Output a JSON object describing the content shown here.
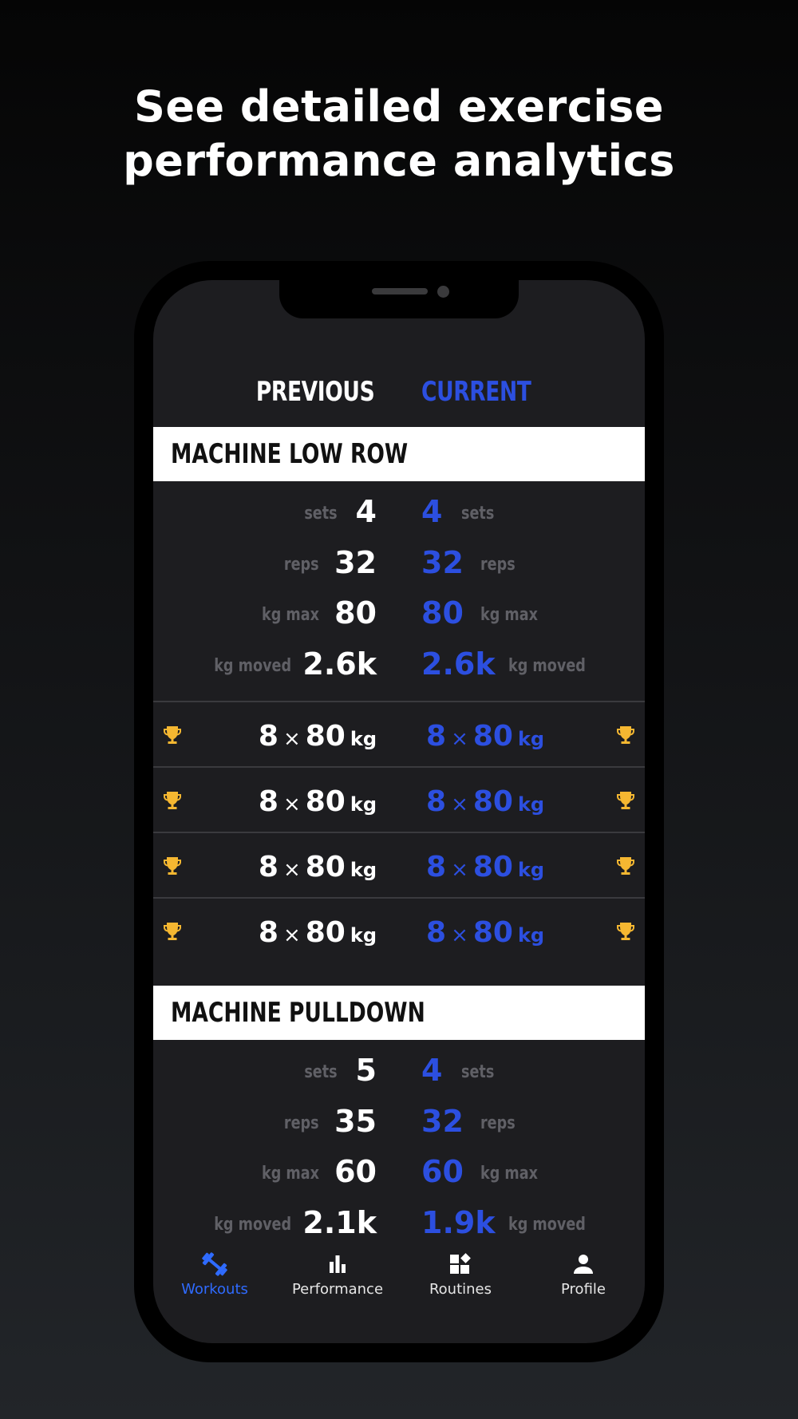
{
  "headline": {
    "line1": "See detailed exercise",
    "line2": "performance analytics"
  },
  "columns": {
    "previous": "PREVIOUS",
    "current": "CURRENT"
  },
  "exercises": [
    {
      "title": "MACHINE LOW ROW",
      "stats": [
        {
          "label": "sets",
          "prev": "4",
          "curr": "4"
        },
        {
          "label": "reps",
          "prev": "32",
          "curr": "32"
        },
        {
          "label": "kg max",
          "prev": "80",
          "curr": "80"
        },
        {
          "label": "kg moved",
          "prev": "2.6k",
          "curr": "2.6k"
        }
      ],
      "sets": [
        {
          "prev_reps": "8",
          "prev_weight": "80",
          "curr_reps": "8",
          "curr_weight": "80",
          "unit": "kg",
          "x": "×"
        },
        {
          "prev_reps": "8",
          "prev_weight": "80",
          "curr_reps": "8",
          "curr_weight": "80",
          "unit": "kg",
          "x": "×"
        },
        {
          "prev_reps": "8",
          "prev_weight": "80",
          "curr_reps": "8",
          "curr_weight": "80",
          "unit": "kg",
          "x": "×"
        },
        {
          "prev_reps": "8",
          "prev_weight": "80",
          "curr_reps": "8",
          "curr_weight": "80",
          "unit": "kg",
          "x": "×"
        }
      ]
    },
    {
      "title": "MACHINE PULLDOWN",
      "stats": [
        {
          "label": "sets",
          "prev": "5",
          "curr": "4"
        },
        {
          "label": "reps",
          "prev": "35",
          "curr": "32"
        },
        {
          "label": "kg max",
          "prev": "60",
          "curr": "60"
        },
        {
          "label": "kg moved",
          "prev": "2.1k",
          "curr": "1.9k"
        }
      ]
    }
  ],
  "tabs": [
    {
      "label": "Workouts",
      "icon": "dumbbell-icon",
      "active": true
    },
    {
      "label": "Performance",
      "icon": "bar-chart-icon",
      "active": false
    },
    {
      "label": "Routines",
      "icon": "routines-icon",
      "active": false
    },
    {
      "label": "Profile",
      "icon": "person-icon",
      "active": false
    }
  ],
  "colors": {
    "accent": "#2c4fe0",
    "tab_active": "#2f6bff",
    "trophy": "#f5b731",
    "screen_bg": "#1d1d20"
  }
}
